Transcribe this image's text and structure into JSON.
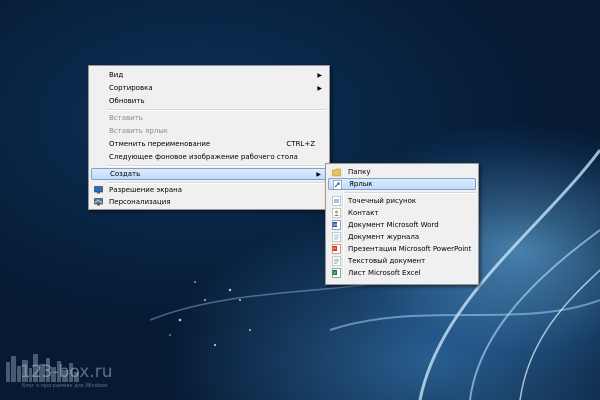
{
  "context_menu": {
    "items": [
      {
        "label": "Вид",
        "has_submenu": true
      },
      {
        "label": "Сортировка",
        "has_submenu": true
      },
      {
        "label": "Обновить"
      },
      {
        "label": "Вставить",
        "disabled": true
      },
      {
        "label": "Вставить ярлык",
        "disabled": true
      },
      {
        "label": "Отменить переименование",
        "shortcut": "CTRL+Z"
      },
      {
        "label": "Следующее фоновое изображение рабочего стола"
      },
      {
        "label": "Создать",
        "has_submenu": true,
        "highlighted": true
      },
      {
        "label": "Разрешение экрана",
        "icon": "display-resolution-icon"
      },
      {
        "label": "Персонализация",
        "icon": "personalization-icon"
      }
    ]
  },
  "create_submenu": {
    "items": [
      {
        "label": "Папку",
        "icon": "folder-icon"
      },
      {
        "label": "Ярлык",
        "icon": "shortcut-icon",
        "highlighted": true
      },
      {
        "label": "Точечный рисунок",
        "icon": "bitmap-icon"
      },
      {
        "label": "Контакт",
        "icon": "contact-icon"
      },
      {
        "label": "Документ Microsoft Word",
        "icon": "word-document-icon"
      },
      {
        "label": "Документ журнала",
        "icon": "journal-document-icon"
      },
      {
        "label": "Презентация Microsoft PowerPoint",
        "icon": "powerpoint-icon"
      },
      {
        "label": "Текстовый документ",
        "icon": "text-document-icon"
      },
      {
        "label": "Лист Microsoft Excel",
        "icon": "excel-icon"
      }
    ]
  },
  "watermark": {
    "title": "123-box.ru",
    "subtitle": "Блог о программах для Windows"
  },
  "colors": {
    "highlight_top": "#dcebfc",
    "highlight_bottom": "#c1dbfc",
    "highlight_border": "#7da2ce",
    "menu_bg": "#f0f0f0"
  }
}
